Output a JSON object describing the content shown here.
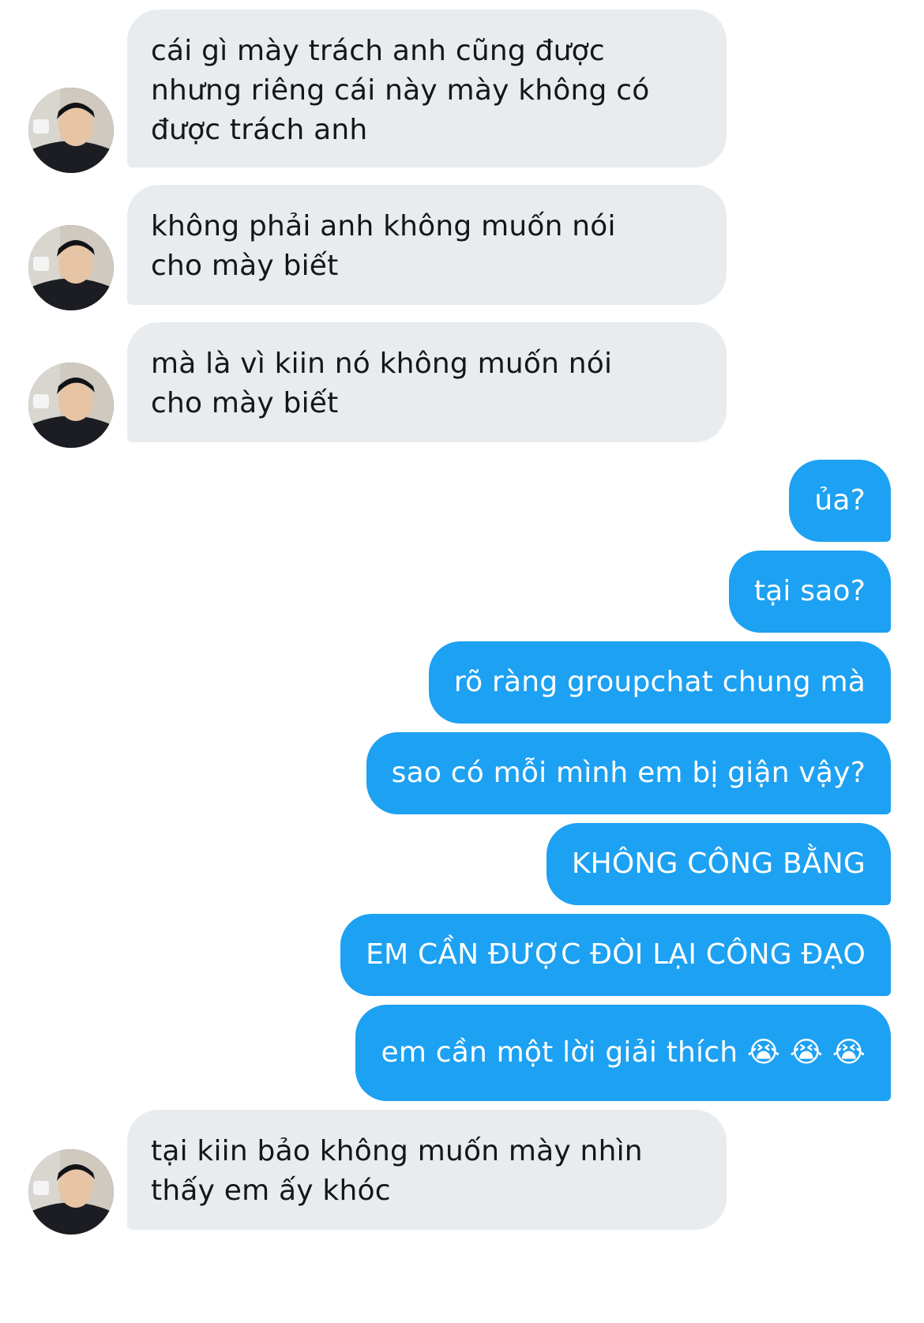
{
  "colors": {
    "incoming_bubble": "#e9ecef",
    "outgoing_bubble": "#1da1f2",
    "incoming_text": "#14171a",
    "outgoing_text": "#ffffff"
  },
  "messages": [
    {
      "from": "other",
      "text": "cái gì mày trách anh cũng được\nnhưng riêng cái này mày không có\nđược trách anh"
    },
    {
      "from": "other",
      "text": "không phải anh không muốn nói\ncho mày biết"
    },
    {
      "from": "other",
      "text": "mà là vì kiin nó không muốn nói\ncho mày biết"
    },
    {
      "from": "me",
      "text": "ủa?"
    },
    {
      "from": "me",
      "text": "tại sao?"
    },
    {
      "from": "me",
      "text": "rõ ràng groupchat chung mà"
    },
    {
      "from": "me",
      "text": "sao có mỗi mình em bị giận vậy?"
    },
    {
      "from": "me",
      "text": "KHÔNG CÔNG BẰNG"
    },
    {
      "from": "me",
      "text": "EM CẦN ĐƯỢC ĐÒI LẠI CÔNG ĐẠO"
    },
    {
      "from": "me",
      "text": "em cần một lời giải thích 😭 😭 😭"
    },
    {
      "from": "other",
      "text": "tại kiin bảo không muốn mày nhìn\nthấy em ấy khóc"
    }
  ],
  "avatar": {
    "icon": "user-avatar-photo"
  }
}
